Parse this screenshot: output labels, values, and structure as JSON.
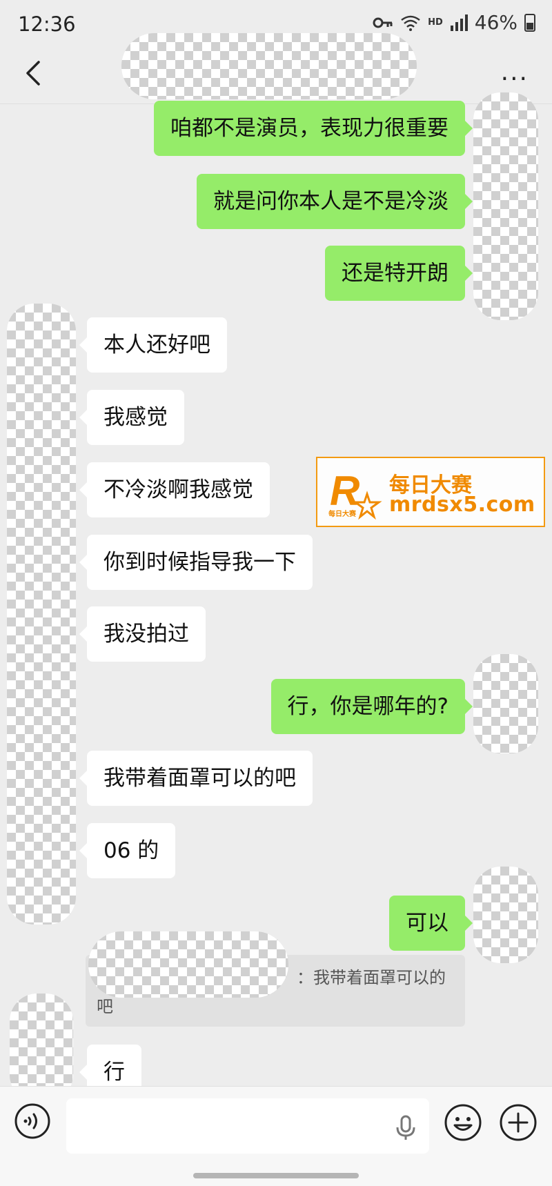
{
  "status": {
    "time": "12:36",
    "hd": "HD",
    "battery": "46%"
  },
  "header": {
    "back_icon": "chevron-left-icon",
    "more_label": "..."
  },
  "messages": [
    {
      "from": "me",
      "text": "咱都不是演员，表现力很重要"
    },
    {
      "from": "me",
      "text": "就是问你本人是不是冷淡"
    },
    {
      "from": "me",
      "text": "还是特开朗"
    },
    {
      "from": "other",
      "text": "本人还好吧"
    },
    {
      "from": "other",
      "text": "我感觉"
    },
    {
      "from": "other",
      "text": "不冷淡啊我感觉"
    },
    {
      "from": "other",
      "text": "你到时候指导我一下"
    },
    {
      "from": "other",
      "text": "我没拍过"
    },
    {
      "from": "me",
      "text": "行，你是哪年的?"
    },
    {
      "from": "other",
      "text": "我带着面罩可以的吧"
    },
    {
      "from": "other",
      "text": "06 的"
    },
    {
      "from": "me",
      "text": "可以"
    },
    {
      "from": "other",
      "text": "行"
    }
  ],
  "quote": {
    "line1": "：我带着面罩可以的",
    "line2": "吧"
  },
  "watermark": {
    "logo_letter": "R",
    "logo_sub": "每日大赛",
    "line1": "每日大赛",
    "line2": "mrdsx5.com"
  },
  "colors": {
    "my_bubble": "#95ec69",
    "other_bubble": "#ffffff",
    "background": "#ededed",
    "watermark_accent": "#f08a00"
  }
}
